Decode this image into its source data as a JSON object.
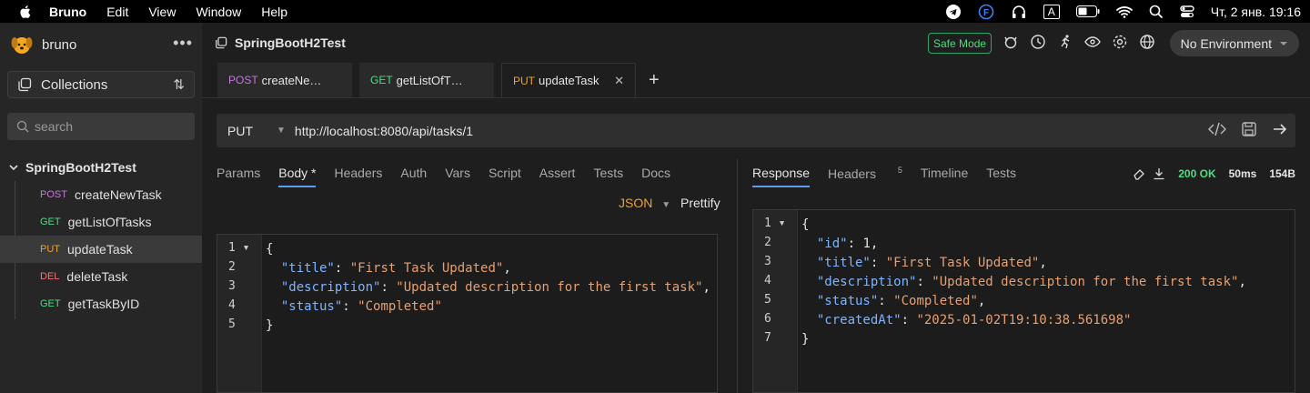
{
  "menubar": {
    "app": "Bruno",
    "items": [
      "Edit",
      "View",
      "Window",
      "Help"
    ],
    "datetime": "Чт, 2 янв.  19:16",
    "input_badge": "A"
  },
  "sidebar": {
    "brand": "bruno",
    "collections_label": "Collections",
    "search_placeholder": "search",
    "collection_name": "SpringBootH2Test",
    "requests": [
      {
        "method": "POST",
        "name": "createNewTask",
        "color": "#c678dd"
      },
      {
        "method": "GET",
        "name": "getListOfTasks",
        "color": "#4ade80"
      },
      {
        "method": "PUT",
        "name": "updateTask",
        "color": "#f0a030"
      },
      {
        "method": "DEL",
        "name": "deleteTask",
        "color": "#f87171"
      },
      {
        "method": "GET",
        "name": "getTaskByID",
        "color": "#4ade80"
      }
    ]
  },
  "header": {
    "collection_title": "SpringBootH2Test",
    "safe_mode": "Safe Mode",
    "environment": "No Environment"
  },
  "tabs": [
    {
      "method": "POST",
      "name": "createNe…",
      "color": "#c678dd"
    },
    {
      "method": "GET",
      "name": "getListOfT…",
      "color": "#4ade80"
    },
    {
      "method": "PUT",
      "name": "updateTask",
      "color": "#f0a030"
    }
  ],
  "request": {
    "method": "PUT",
    "url": "http://localhost:8080/api/tasks/1"
  },
  "request_tabs": [
    "Params",
    "Body *",
    "Headers",
    "Auth",
    "Vars",
    "Script",
    "Assert",
    "Tests",
    "Docs"
  ],
  "body_mode": "JSON",
  "prettify": "Prettify",
  "response_tabs": {
    "response": "Response",
    "headers": "Headers",
    "headers_count": "5",
    "timeline": "Timeline",
    "tests": "Tests"
  },
  "response_status": {
    "code": "200 OK",
    "time": "50ms",
    "size": "154B"
  }
}
